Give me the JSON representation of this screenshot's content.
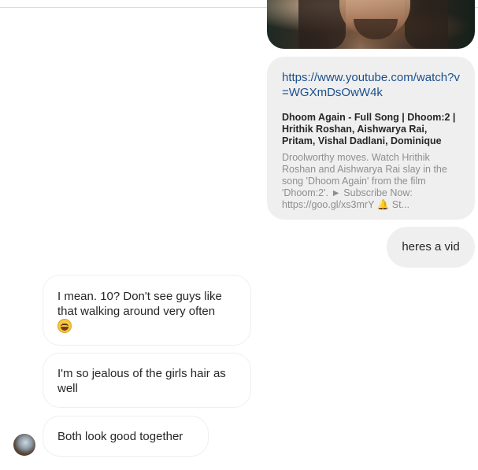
{
  "link_preview": {
    "url": "https://www.youtube.com/watch?v=WGXmDsOwW4k",
    "title": "Dhoom Again - Full Song | Dhoom:2 | Hrithik Roshan, Aishwarya Rai, Pritam, Vishal Dadlani, Dominique",
    "description": "Droolworthy moves. Watch Hrithik Roshan and Aishwarya Rai slay in the song 'Dhoom Again' from the film 'Dhoom:2'. ► Subscribe Now: https://goo.gl/xs3mrY",
    "description_tail": "St..."
  },
  "messages": {
    "sent": [
      {
        "text": "heres a vid"
      }
    ],
    "received": [
      {
        "text": "I mean. 10? Don't see guys like that walking around very often"
      },
      {
        "text": "I'm so jealous of the girls hair as well"
      },
      {
        "text": "Both look good together"
      }
    ]
  },
  "icons": {
    "bell": "bell-icon",
    "emoji": "grinning-sweat-emoji",
    "avatar": "user-avatar"
  },
  "colors": {
    "link": "#1b4f8c",
    "bubble_gray": "#efefef",
    "muted_text": "#8e8e8e"
  }
}
